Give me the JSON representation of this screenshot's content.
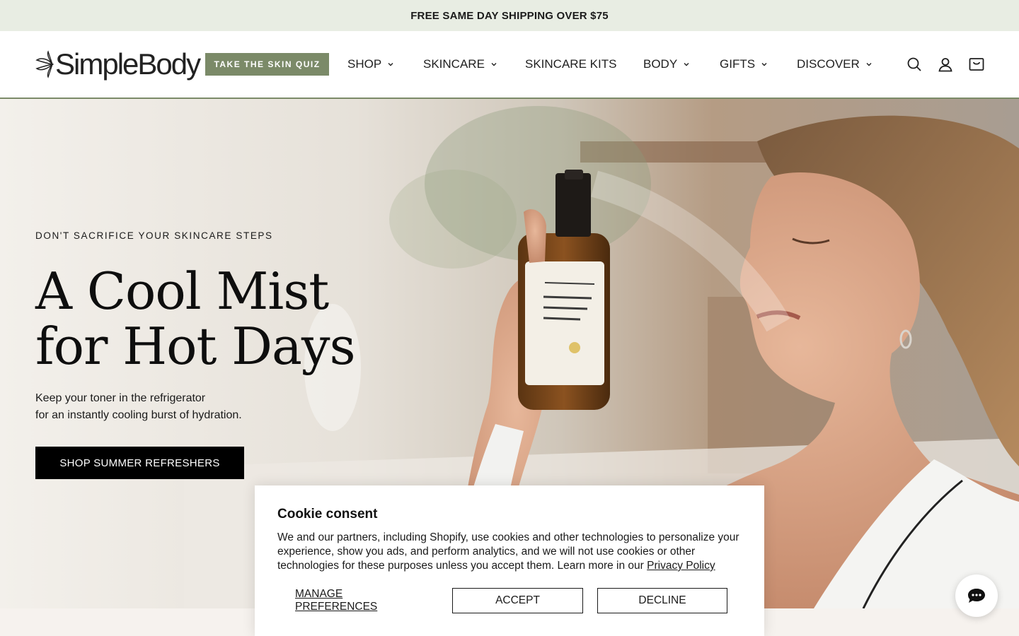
{
  "announcement": {
    "text": "FREE SAME DAY SHIPPING OVER $75"
  },
  "header": {
    "logo_text": "SimpleBody",
    "quiz_label": "TAKE THE SKIN QUIZ",
    "nav": [
      {
        "label": "SHOP",
        "has_dropdown": true
      },
      {
        "label": "SKINCARE",
        "has_dropdown": true
      },
      {
        "label": "SKINCARE KITS",
        "has_dropdown": false
      },
      {
        "label": "BODY",
        "has_dropdown": true
      },
      {
        "label": "GIFTS",
        "has_dropdown": true
      },
      {
        "label": "DISCOVER",
        "has_dropdown": true
      }
    ],
    "icons": [
      "search-icon",
      "account-icon",
      "cart-icon"
    ]
  },
  "hero": {
    "eyebrow": "DON'T SACRIFICE YOUR SKINCARE STEPS",
    "headline_line1": "A Cool Mist",
    "headline_line2": "for Hot Days",
    "subcopy_line1": "Keep your toner in the refrigerator",
    "subcopy_line2": "for an instantly cooling burst of hydration.",
    "cta_label": "SHOP SUMMER REFRESHERS"
  },
  "cookie": {
    "title": "Cookie consent",
    "body": "We and our partners, including Shopify, use cookies and other technologies to personalize your experience, show you ads, and perform analytics, and we will not use cookies or other technologies for these purposes unless you accept them. Learn more in our",
    "policy_link": "Privacy Policy",
    "manage_label": "MANAGE PREFERENCES",
    "accept_label": "ACCEPT",
    "decline_label": "DECLINE"
  },
  "colors": {
    "announcement_bg": "#e8ede3",
    "brand_green": "#7b8a68",
    "cta_bg": "#000000"
  }
}
